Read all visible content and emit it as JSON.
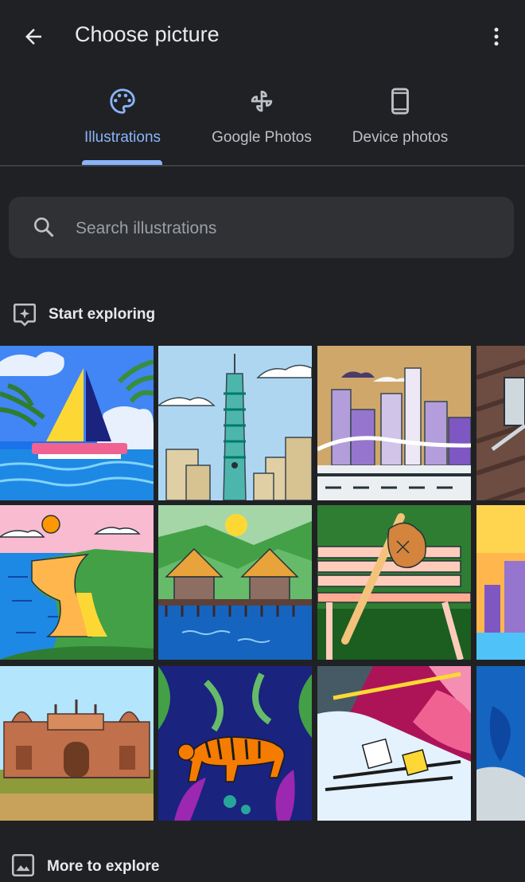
{
  "header": {
    "title": "Choose picture"
  },
  "tabs": [
    {
      "label": "Illustrations",
      "icon": "palette-icon",
      "active": true
    },
    {
      "label": "Google Photos",
      "icon": "pinwheel-icon",
      "active": false
    },
    {
      "label": "Device photos",
      "icon": "phone-icon",
      "active": false
    }
  ],
  "search": {
    "placeholder": "Search illustrations",
    "value": ""
  },
  "sections": {
    "start_exploring": "Start exploring",
    "more_to_explore": "More to explore"
  },
  "colors": {
    "background": "#202124",
    "accent": "#8ab4f8",
    "search_bg": "#303134"
  },
  "illustrations": [
    {
      "row": 1,
      "subject": "sailboat-illustration"
    },
    {
      "row": 1,
      "subject": "tower-city-illustration"
    },
    {
      "row": 1,
      "subject": "skyline-illustration"
    },
    {
      "row": 1,
      "subject": "deck-chair-illustration"
    },
    {
      "row": 2,
      "subject": "coastal-cliff-illustration"
    },
    {
      "row": 2,
      "subject": "overwater-huts-illustration"
    },
    {
      "row": 2,
      "subject": "baseball-bench-illustration"
    },
    {
      "row": 2,
      "subject": "sunset-city-illustration"
    },
    {
      "row": 3,
      "subject": "red-fort-illustration"
    },
    {
      "row": 3,
      "subject": "tiger-jungle-illustration"
    },
    {
      "row": 3,
      "subject": "skier-illustration"
    },
    {
      "row": 3,
      "subject": "blue-abstract-illustration"
    }
  ]
}
